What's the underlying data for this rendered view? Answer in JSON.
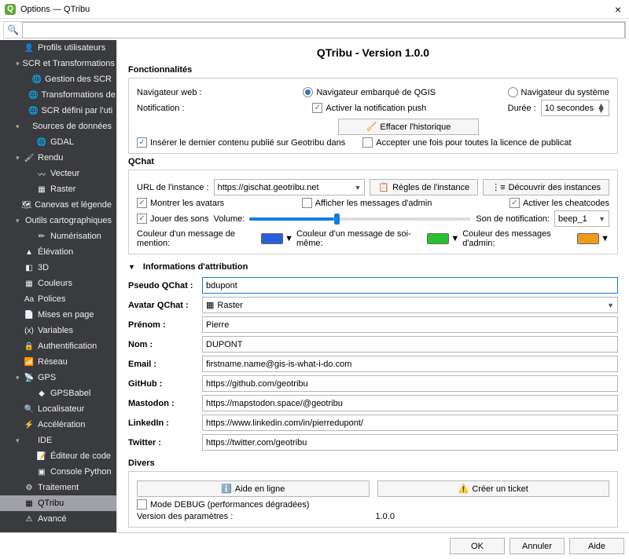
{
  "window": {
    "title": "Options — QTribu",
    "close": "×"
  },
  "search": {
    "placeholder": ""
  },
  "sidebar": {
    "items": [
      {
        "lvl": 1,
        "ic": "👤",
        "label": "Profils utilisateurs"
      },
      {
        "lvl": 1,
        "ic": "",
        "label": "SCR et Transformations",
        "arrow": "▾"
      },
      {
        "lvl": 2,
        "ic": "🌐",
        "label": "Gestion des SCR"
      },
      {
        "lvl": 2,
        "ic": "🌐",
        "label": "Transformations de"
      },
      {
        "lvl": 2,
        "ic": "🌐",
        "label": "SCR défini par l'uti"
      },
      {
        "lvl": 1,
        "ic": "",
        "label": "Sources de données",
        "arrow": "▾"
      },
      {
        "lvl": 2,
        "ic": "🌐",
        "label": "GDAL"
      },
      {
        "lvl": 1,
        "ic": "🖌",
        "label": "Rendu",
        "arrow": "▾"
      },
      {
        "lvl": 2,
        "ic": "〰",
        "label": "Vecteur"
      },
      {
        "lvl": 2,
        "ic": "▦",
        "label": "Raster"
      },
      {
        "lvl": 1,
        "ic": "🗺",
        "label": "Canevas et légende"
      },
      {
        "lvl": 1,
        "ic": "",
        "label": "Outils cartographiques",
        "arrow": "▾"
      },
      {
        "lvl": 2,
        "ic": "✏",
        "label": "Numérisation"
      },
      {
        "lvl": 1,
        "ic": "▲",
        "label": "Élévation"
      },
      {
        "lvl": 1,
        "ic": "◧",
        "label": "3D"
      },
      {
        "lvl": 1,
        "ic": "▦",
        "label": "Couleurs"
      },
      {
        "lvl": 1,
        "ic": "Aa",
        "label": "Polices"
      },
      {
        "lvl": 1,
        "ic": "📄",
        "label": "Mises en page"
      },
      {
        "lvl": 1,
        "ic": "(x)",
        "label": "Variables"
      },
      {
        "lvl": 1,
        "ic": "🔒",
        "label": "Authentification"
      },
      {
        "lvl": 1,
        "ic": "📶",
        "label": "Réseau"
      },
      {
        "lvl": 1,
        "ic": "📡",
        "label": "GPS",
        "arrow": "▾"
      },
      {
        "lvl": 2,
        "ic": "◆",
        "label": "GPSBabel"
      },
      {
        "lvl": 1,
        "ic": "🔍",
        "label": "Localisateur"
      },
      {
        "lvl": 1,
        "ic": "⚡",
        "label": "Accélération"
      },
      {
        "lvl": 1,
        "ic": "",
        "label": "IDE",
        "arrow": "▾"
      },
      {
        "lvl": 2,
        "ic": "📝",
        "label": "Éditeur de code"
      },
      {
        "lvl": 2,
        "ic": "▣",
        "label": "Console Python"
      },
      {
        "lvl": 1,
        "ic": "⚙",
        "label": "Traitement"
      },
      {
        "lvl": 1,
        "ic": "▦",
        "label": "QTribu",
        "selected": true
      },
      {
        "lvl": 1,
        "ic": "⚠",
        "label": "Avancé"
      }
    ]
  },
  "page": {
    "title": "QTribu - Version 1.0.0"
  },
  "func": {
    "heading": "Fonctionnalités",
    "browser_label": "Navigateur web :",
    "browser_opt_embedded": "Navigateur embarqué de QGIS",
    "browser_opt_system": "Navigateur du système",
    "notif_label": "Notification :",
    "notif_enable": "Activer la notification push",
    "duration_label": "Durée :",
    "duration_value": "10 secondes",
    "clear_history": "Effacer l'historique",
    "insert_last": "Insérer le dernier contenu publié sur Geotribu dans",
    "accept_once": "Accepter une fois pour toutes la licence de publicat"
  },
  "qchat": {
    "heading": "QChat",
    "url_label": "URL de l'instance :",
    "url_value": "https://gischat.geotribu.net",
    "rules_btn": "Règles de l'instance",
    "discover_btn": "Découvrir des instances",
    "show_avatars": "Montrer les avatars",
    "show_admin": "Afficher les messages d'admin",
    "cheatcodes": "Activer les cheatcodes",
    "play_sounds": "Jouer des sons",
    "volume_label": "Volume:",
    "notif_sound_label": "Son de notification:",
    "notif_sound_value": "beep_1",
    "color_mention": "Couleur d'un message de mention:",
    "color_self": "Couleur d'un message de soi-même:",
    "color_admin": "Couleur des messages d'admin:",
    "colors": {
      "mention": "#2a5fd9",
      "self": "#28c22e",
      "admin": "#f09a1a"
    }
  },
  "attrib": {
    "heading": "Informations d'attribution",
    "pseudo_label": "Pseudo QChat :",
    "pseudo_value": "bdupont",
    "avatar_label": "Avatar QChat :",
    "avatar_value": "Raster",
    "firstname_label": "Prénom :",
    "firstname_value": "Pierre",
    "lastname_label": "Nom :",
    "lastname_value": "DUPONT",
    "email_label": "Email :",
    "email_value": "firstname.name@gis-is-what-i-do.com",
    "github_label": "GitHub :",
    "github_value": "https://github.com/geotribu",
    "mastodon_label": "Mastodon :",
    "mastodon_value": "https://mapstodon.space/@geotribu",
    "linkedin_label": "LinkedIn :",
    "linkedin_value": "https://www.linkedin.com/in/pierredupont/",
    "twitter_label": "Twitter :",
    "twitter_value": "https://twitter.com/geotribu"
  },
  "misc": {
    "heading": "Divers",
    "help_btn": "Aide en ligne",
    "ticket_btn": "Créer un ticket",
    "debug": "Mode DEBUG (performances dégradées)",
    "settings_version_label": "Version des paramètres :",
    "settings_version_value": "1.0.0"
  },
  "footer": {
    "ok": "OK",
    "cancel": "Annuler",
    "help": "Aide"
  }
}
